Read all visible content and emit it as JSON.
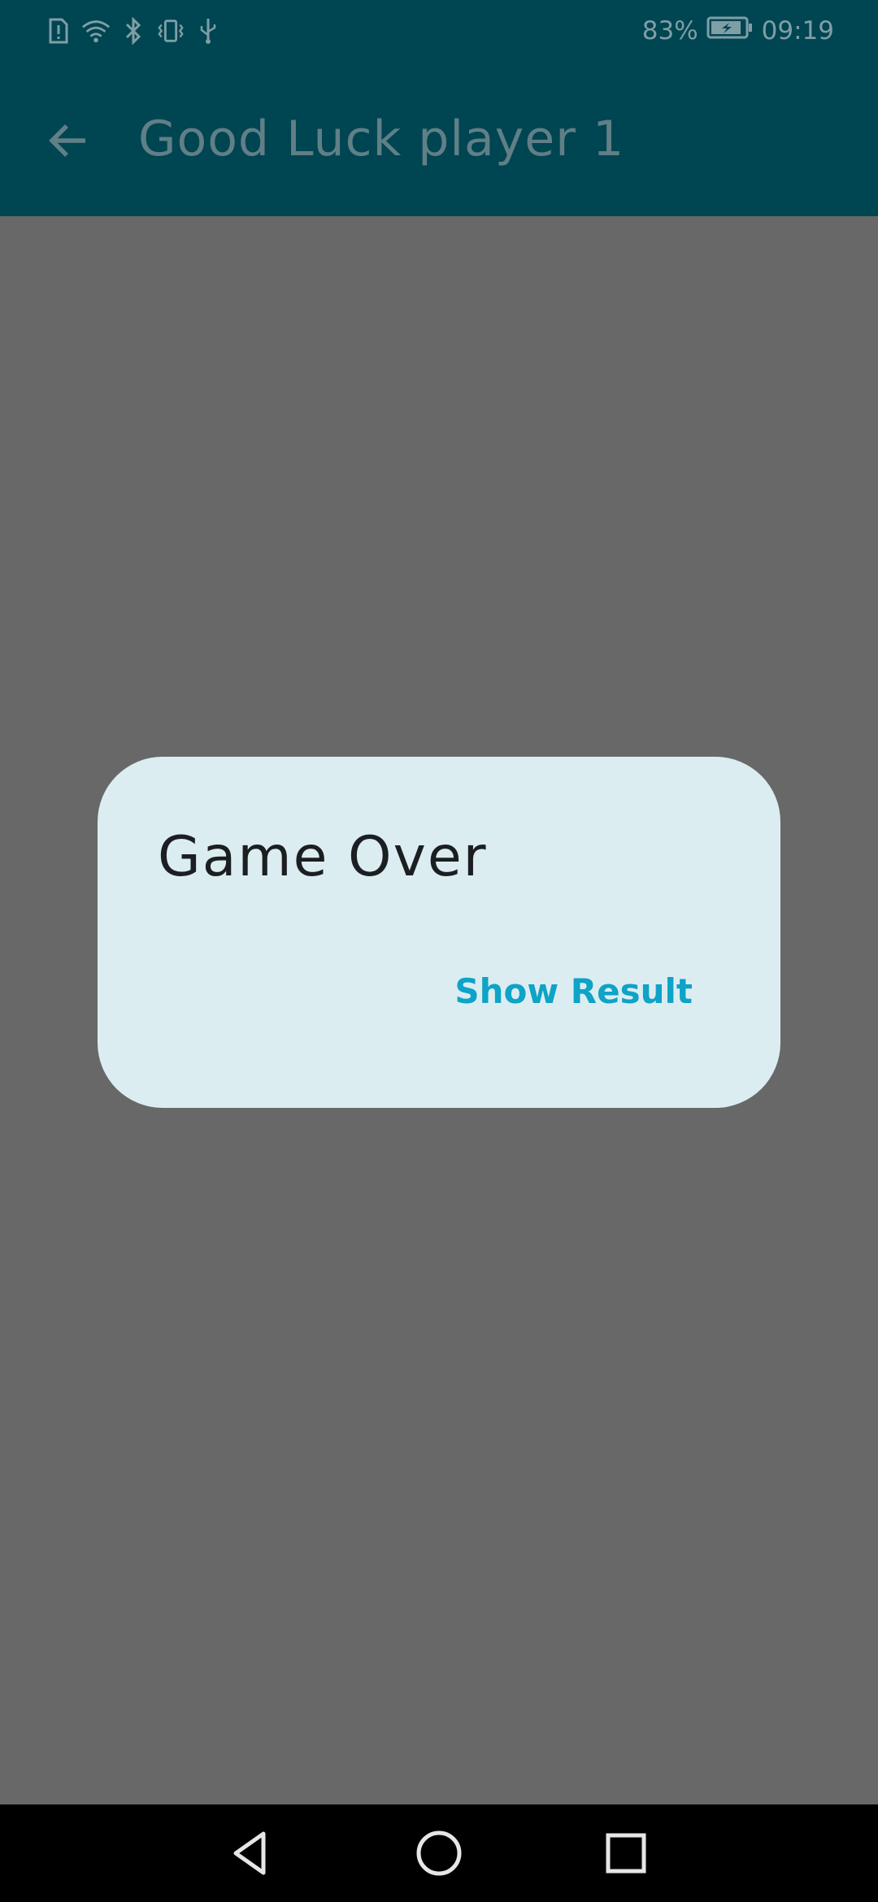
{
  "status_bar": {
    "battery_percent": "83%",
    "time": "09:19",
    "icons": [
      "sim-alert-icon",
      "wifi-icon",
      "bluetooth-icon",
      "vibrate-icon",
      "usb-icon",
      "battery-charging-icon"
    ]
  },
  "app_bar": {
    "title": "Good Luck player 1",
    "back_icon": "arrow-back-icon"
  },
  "dialog": {
    "title": "Game Over",
    "action_label": "Show Result"
  },
  "nav_bar": {
    "icons": [
      "back-triangle-icon",
      "home-circle-icon",
      "recents-square-icon"
    ]
  },
  "colors": {
    "app_bar": "#004552",
    "scrim_background": "#686868",
    "dialog_background": "#dcedf1",
    "accent": "#0ea3c7"
  }
}
